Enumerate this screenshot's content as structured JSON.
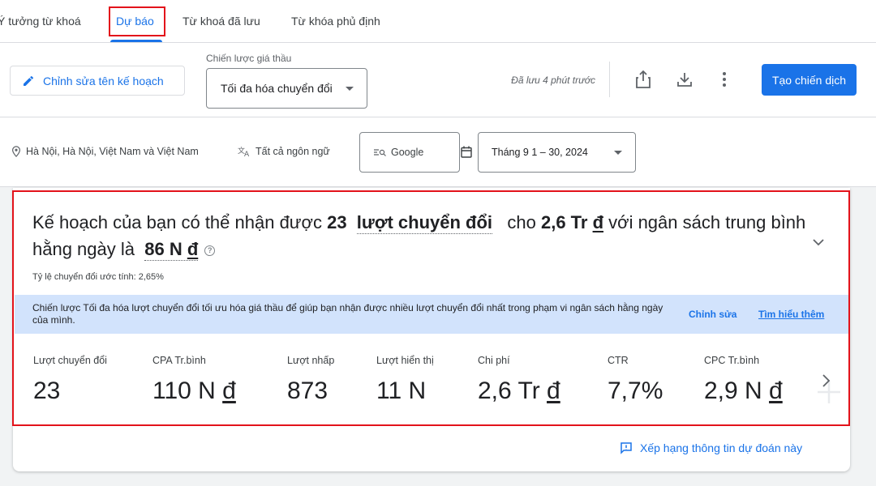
{
  "tabs": [
    {
      "label": "Ý tưởng từ khoá"
    },
    {
      "label": "Dự báo"
    },
    {
      "label": "Từ khoá đã lưu"
    },
    {
      "label": "Từ khóa phủ định"
    }
  ],
  "toolbar": {
    "edit_plan_label": "Chỉnh sửa tên kế hoạch",
    "bid_strategy_label": "Chiến lược giá thầu",
    "bid_strategy_value": "Tối đa hóa chuyển đổi",
    "saved_text": "Đã lưu 4 phút trước",
    "create_campaign_label": "Tạo chiến dịch"
  },
  "filters": {
    "location": "Hà Nội, Hà Nội, Việt Nam và Việt Nam",
    "language": "Tất cả ngôn ngữ",
    "network": "Google",
    "date_range": "Tháng 9 1 – 30, 2024"
  },
  "summary": {
    "part1": "Kế hoạch của bạn có thể nhận được ",
    "conversions_count": "23",
    "conversions_label": "lượt chuyển đổi",
    "part2": "cho ",
    "cost": "2,6 Tr ",
    "cost_currency": "đ",
    "part3": " với ngân sách trung bình hằng ngày là ",
    "budget": "86 N ",
    "budget_currency": "đ",
    "help_glyph": "?",
    "conversion_rate": "Tỷ lệ chuyển đổi ước tính: 2,65%"
  },
  "info_bar": {
    "text": "Chiến lược Tối đa hóa lượt chuyển đổi tối ưu hóa giá thầu để giúp bạn nhận được nhiều lượt chuyển đổi nhất trong phạm vi ngân sách hằng ngày của mình.",
    "edit_label": "Chỉnh sửa",
    "learn_more_label": "Tìm hiểu thêm"
  },
  "metrics": [
    {
      "label": "Lượt chuyển đổi",
      "value": "23",
      "currency": ""
    },
    {
      "label": "CPA Tr.bình",
      "value": "110 N ",
      "currency": "đ"
    },
    {
      "label": "Lượt nhấp",
      "value": "873",
      "currency": ""
    },
    {
      "label": "Lượt hiển thị",
      "value": "11 N",
      "currency": ""
    },
    {
      "label": "Chi phí",
      "value": "2,6 Tr ",
      "currency": "đ"
    },
    {
      "label": "CTR",
      "value": "7,7%",
      "currency": ""
    },
    {
      "label": "CPC Tr.bình",
      "value": "2,9 N ",
      "currency": "đ"
    }
  ],
  "footer": {
    "rank_label": "Xếp hạng thông tin dự đoán này"
  },
  "colors": {
    "accent": "#1a73e8",
    "highlight": "#e3131b",
    "info_bg": "#d2e3fc"
  },
  "icons": [
    "pencil-icon",
    "share-icon",
    "download-icon",
    "more-vert-icon",
    "location-pin-icon",
    "translate-icon",
    "search-network-icon",
    "calendar-icon",
    "chevron-down-icon",
    "chevron-right-icon",
    "feedback-icon"
  ]
}
